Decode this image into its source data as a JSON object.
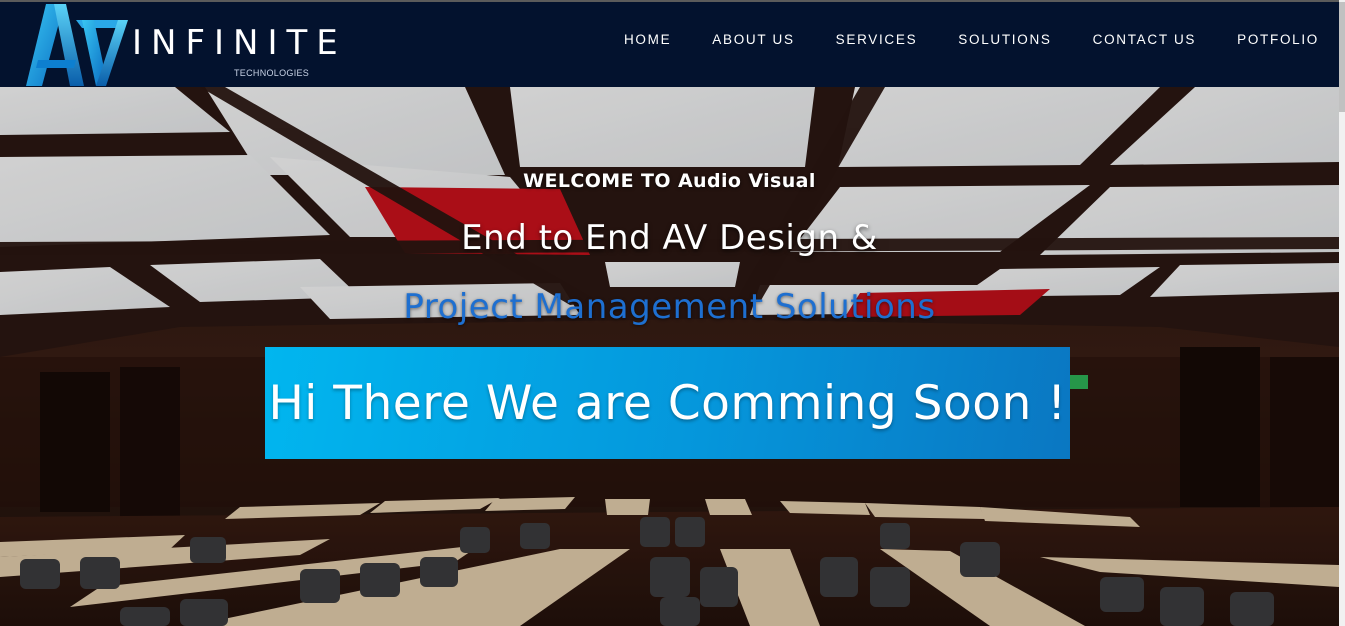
{
  "header": {
    "logo": {
      "mark": "AV",
      "word": "INFINITE",
      "subtitle": "TECHNOLOGIES"
    },
    "nav": [
      {
        "label": "HOME"
      },
      {
        "label": "ABOUT US"
      },
      {
        "label": "SERVICES"
      },
      {
        "label": "SOLUTIONS"
      },
      {
        "label": "CONTACT US"
      },
      {
        "label": "POTFOLIO"
      }
    ]
  },
  "hero": {
    "welcome": "WELCOME  TO  Audio  Visual",
    "headline": "End to End AV Design &",
    "subline": "Project  Management  Solutions",
    "banner": "Hi There We are Comming Soon !"
  },
  "colors": {
    "header_bg": "#03122e",
    "accent_blue": "#1e6fd0",
    "banner_start": "#01b6ef",
    "banner_end": "#0a77c2"
  }
}
